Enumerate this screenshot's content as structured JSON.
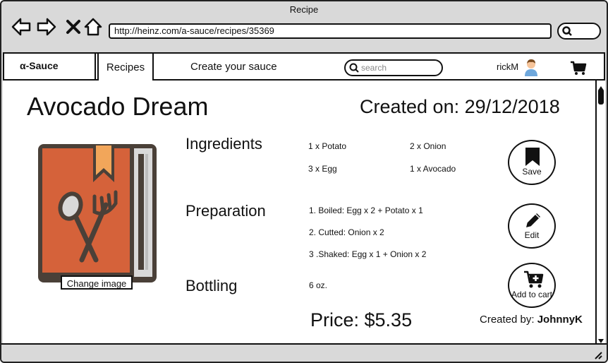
{
  "window": {
    "title": "Recipe"
  },
  "browser": {
    "url": "http://heinz.com/a-sauce/recipes/35369"
  },
  "nav": {
    "brand": "α-Sauce",
    "recipes": "Recipes",
    "create": "Create your sauce",
    "search_placeholder": "search",
    "user": "rickM"
  },
  "recipe": {
    "title": "Avocado Dream",
    "created": "Created on: 29/12/2018",
    "sections": {
      "ingredients": "Ingredients",
      "preparation": "Preparation",
      "bottling": "Bottling"
    },
    "ingredients": [
      "1 x Potato",
      "2 x Onion",
      "3 x Egg",
      "1 x Avocado"
    ],
    "steps": [
      "1. Boiled: Egg x 2 + Potato x 1",
      "2. Cutted: Onion x 2",
      "3 .Shaked: Egg x 1 + Onion x 2"
    ],
    "bottling": "6 oz.",
    "price": "Price: $5.35",
    "created_by_label": "Created by: ",
    "created_by_user": "JohnnyK",
    "change_image": "Change image"
  },
  "actions": {
    "save": "Save",
    "edit": "Edit",
    "add_to_cart": "Add to cart"
  },
  "icons": [
    "back-arrow-icon",
    "forward-arrow-icon",
    "close-icon",
    "home-icon",
    "search-icon",
    "avatar-icon",
    "cart-icon",
    "bookmark-icon",
    "pencil-icon",
    "cart-add-icon",
    "recipe-book-icon"
  ],
  "colors": {
    "book_orange": "#d5623a",
    "book_dark": "#4a4038",
    "ribbon": "#f2a65a"
  }
}
